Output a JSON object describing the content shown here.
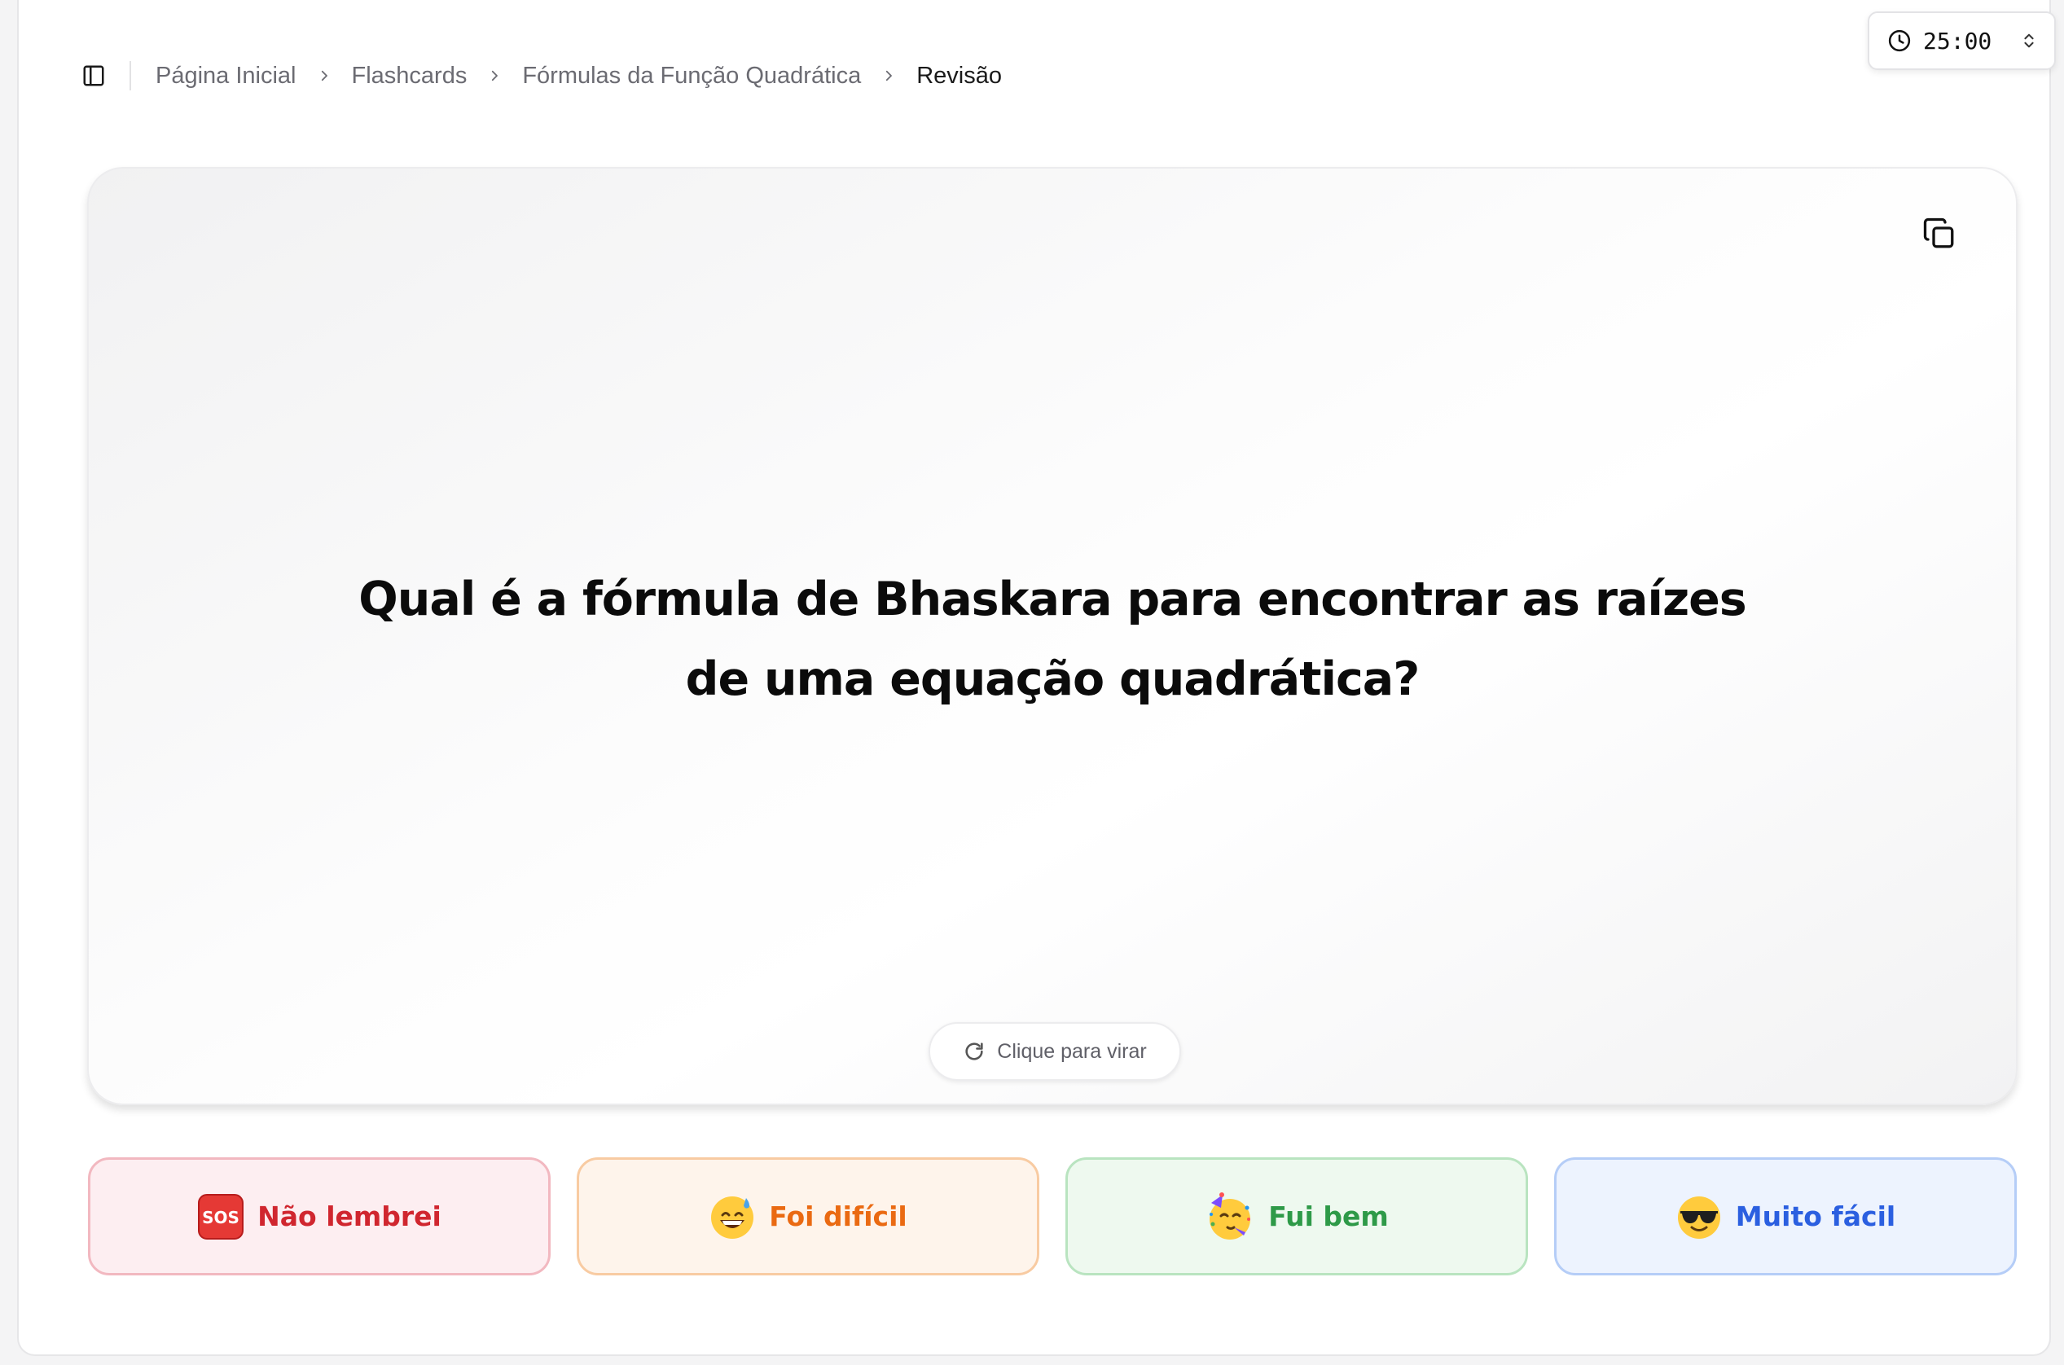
{
  "header": {
    "sidebar_toggle_icon": "sidebar-panel-icon",
    "breadcrumb": [
      {
        "label": "Página Inicial"
      },
      {
        "label": "Flashcards"
      },
      {
        "label": "Fórmulas da Função Quadrática"
      },
      {
        "label": "Revisão"
      }
    ]
  },
  "timer": {
    "icon": "clock-icon",
    "value": "25:00",
    "stepper_icon": "chevron-up-down-icon"
  },
  "card": {
    "question": "Qual é a fórmula de Bhaskara para encontrar as raízes de uma equação quadrática?",
    "copy_icon": "copy-icon",
    "flip_hint": "Clique para virar",
    "flip_icon": "refresh-icon"
  },
  "rating": {
    "buttons": [
      {
        "label": "Não lembrei",
        "icon": "sos-emoji",
        "color": "#d0262f"
      },
      {
        "label": "Foi difícil",
        "icon": "grinning-sweat-emoji",
        "color": "#ea6a12"
      },
      {
        "label": "Fui bem",
        "icon": "partying-face-emoji",
        "color": "#2e9a48"
      },
      {
        "label": "Muito fácil",
        "icon": "sunglasses-face-emoji",
        "color": "#2b5fe0"
      }
    ]
  }
}
